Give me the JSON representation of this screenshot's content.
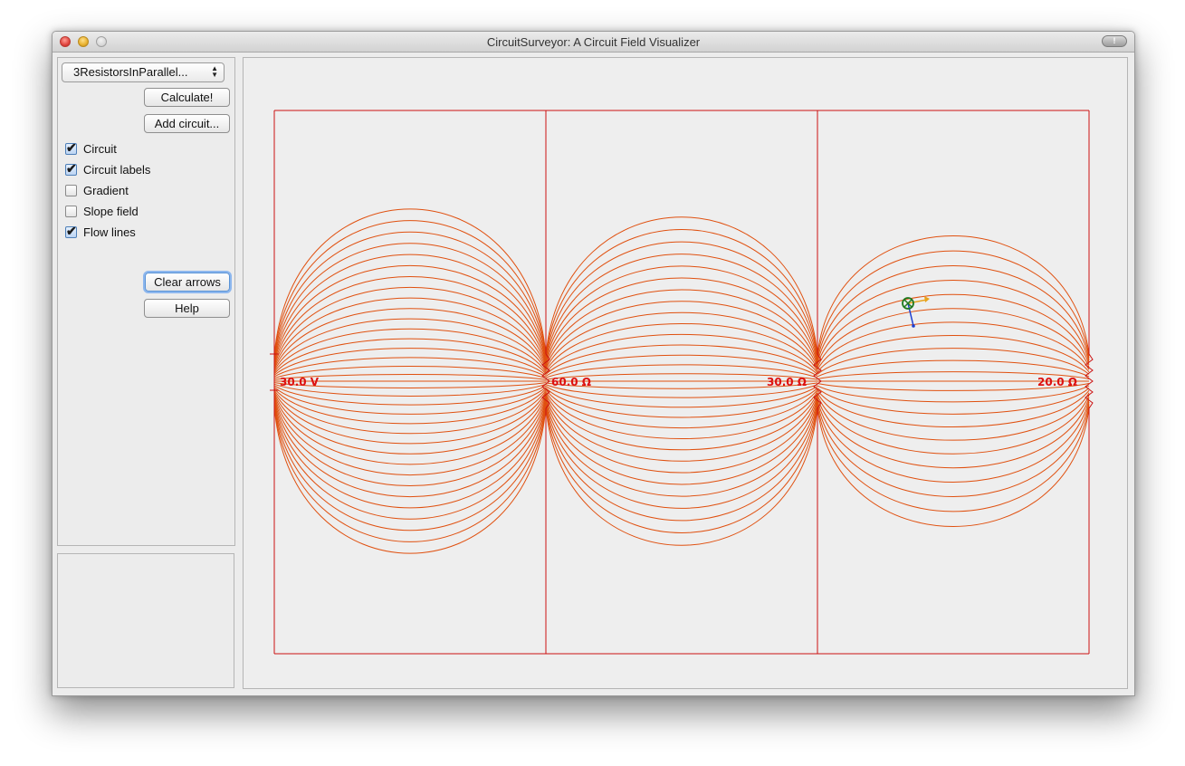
{
  "window": {
    "title": "CircuitSurveyor: A Circuit Field Visualizer"
  },
  "controls": {
    "circuit_select": "3ResistorsInParallel...",
    "calculate_label": "Calculate!",
    "add_circuit_label": "Add circuit...",
    "checkboxes": [
      {
        "label": "Circuit",
        "checked": true
      },
      {
        "label": "Circuit labels",
        "checked": true
      },
      {
        "label": "Gradient",
        "checked": false
      },
      {
        "label": "Slope field",
        "checked": false
      },
      {
        "label": "Flow lines",
        "checked": true
      }
    ],
    "clear_arrows_label": "Clear arrows",
    "help_label": "Help"
  },
  "circuit": {
    "wire_color": "#cc1111",
    "flow_color": "#e0500f",
    "labels": [
      "30.0 V",
      "60.0 Ω",
      "30.0 Ω",
      "20.0 Ω"
    ]
  },
  "icons": {
    "traffic": [
      "close-icon",
      "minimize-icon",
      "zoom-icon"
    ],
    "fullscreen": "fullscreen-icon",
    "probe": "probe-marker-icon"
  }
}
